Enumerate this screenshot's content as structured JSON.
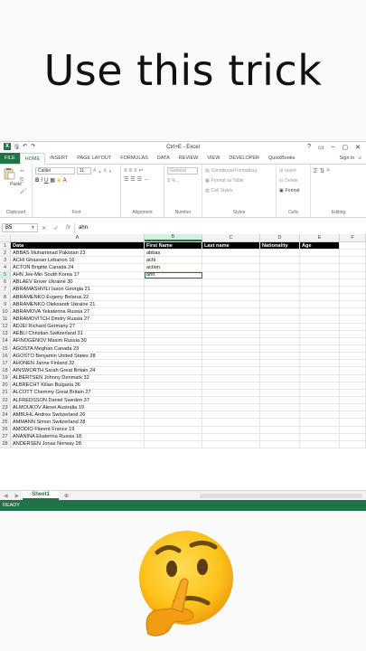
{
  "caption": "Use this trick",
  "window": {
    "title": "Ctrl+E - Excel",
    "qa_icons": [
      "save-icon",
      "undo-icon",
      "redo-icon"
    ],
    "controls": [
      "?",
      "▭",
      "–",
      "▢",
      "✕"
    ]
  },
  "tabs": [
    "FILE",
    "HOME",
    "INSERT",
    "PAGE LAYOUT",
    "FORMULAS",
    "DATA",
    "REVIEW",
    "VIEW",
    "DEVELOPER",
    "QuickBooks"
  ],
  "active_tab": "HOME",
  "sign_in": "Sign in",
  "ribbon": {
    "clipboard": {
      "paste": "Paste",
      "name": "Clipboard"
    },
    "font": {
      "family": "Calibri",
      "size": "11",
      "name": "Font",
      "bold": "B",
      "italic": "I",
      "underline": "U"
    },
    "alignment": {
      "name": "Alignment"
    },
    "number": {
      "format": "General",
      "name": "Number"
    },
    "styles": {
      "cond": "Conditional Formatting",
      "table": "Format as Table",
      "cell": "Cell Styles",
      "name": "Styles"
    },
    "cells": {
      "insert": "Insert",
      "delete": "Delete",
      "format": "Format",
      "name": "Cells"
    },
    "editing": {
      "name": "Editing"
    }
  },
  "formula_bar": {
    "name_box": "B5",
    "fx": "fx",
    "value": "ahn"
  },
  "columns": [
    "A",
    "B",
    "C",
    "D",
    "E",
    "F"
  ],
  "headers": [
    "Data",
    "First Name",
    "Last name",
    "Nationality",
    "Age",
    ""
  ],
  "rows": [
    [
      "ABBAS Muhammad Pakistan 23",
      "abbas"
    ],
    [
      "ACHI Ghassan Lebanon 16",
      "achi"
    ],
    [
      "ACTON Brigitte Canada 24",
      "action"
    ],
    [
      "AHN Jee-Min South Korea 17",
      "ahn"
    ],
    [
      "ABLAEV Enver Ukraine 30",
      ""
    ],
    [
      "ABRAMASHVILI Iason Georgia 21",
      ""
    ],
    [
      "ABRAMENKO Evgeny Belarus 22",
      ""
    ],
    [
      "ABRAMENKO Oleksandr Ukraine 21",
      ""
    ],
    [
      "ABRAMOVA Yekaterina Russia 27",
      ""
    ],
    [
      "ABRAMOVITCH Dmitry Russia 27",
      ""
    ],
    [
      "ADJEI Richard Germany 27",
      ""
    ],
    [
      "AEBLI Christian Switzerland 31",
      ""
    ],
    [
      "AFINOGENOV Maxim Russia 30",
      ""
    ],
    [
      "AGOSTA Meghan Canada 23",
      ""
    ],
    [
      "AGOSTO Benjamin United States 28",
      ""
    ],
    [
      "AHONEN Janne Finland 32",
      ""
    ],
    [
      "AINSWORTH Sarah Great Britain 24",
      ""
    ],
    [
      "ALBERTSEN Johnny Denmark 32",
      ""
    ],
    [
      "ALBRECHT Kilian Bulgaria 36",
      ""
    ],
    [
      "ALCOTT Chemmy Great Britain 27",
      ""
    ],
    [
      "ALFREDSSON Daniel Sweden 37",
      ""
    ],
    [
      "ALMOUKOV Alexei Australia 19",
      ""
    ],
    [
      "AMBUHL Andres Switzerland 26",
      ""
    ],
    [
      "AMMANN Simon Switzerland 28",
      ""
    ],
    [
      "AMODIO Florent France 19",
      ""
    ],
    [
      "ANANINA Ekaterina Russia 18",
      ""
    ],
    [
      "ANDERSEN Jonas Norway 28",
      ""
    ]
  ],
  "sheet_tab": "Sheet1",
  "status": "READY"
}
